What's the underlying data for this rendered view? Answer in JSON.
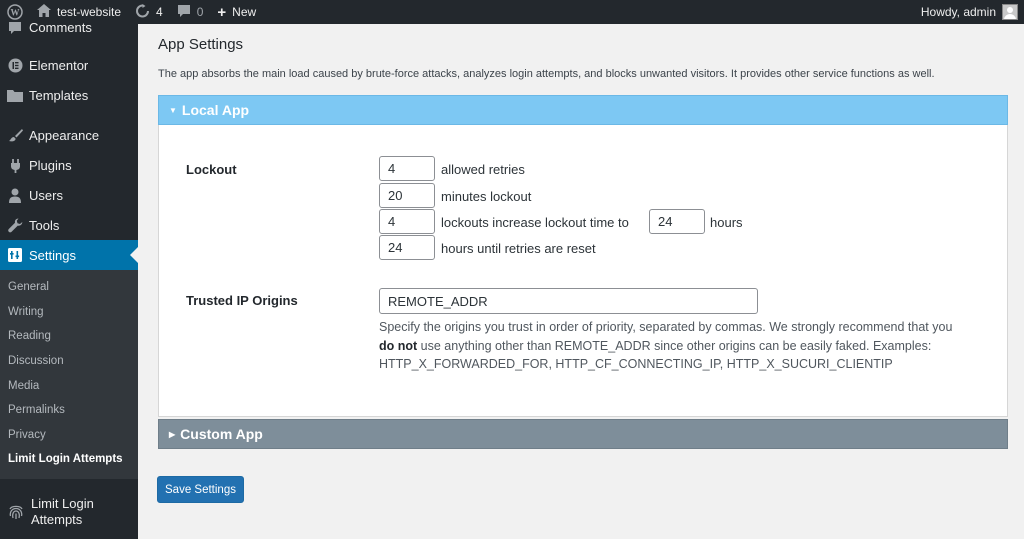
{
  "adminbar": {
    "site_name": "test-website",
    "updates_count": "4",
    "comments_count": "0",
    "new_label": "New",
    "greeting": "Howdy, admin"
  },
  "sidebar": {
    "items": [
      {
        "label": "Comments",
        "icon": "comment-icon"
      },
      {
        "label": "Elementor",
        "icon": "elementor-icon"
      },
      {
        "label": "Templates",
        "icon": "folder-icon"
      },
      {
        "label": "Appearance",
        "icon": "paintbrush-icon"
      },
      {
        "label": "Plugins",
        "icon": "plugin-icon"
      },
      {
        "label": "Users",
        "icon": "users-icon"
      },
      {
        "label": "Tools",
        "icon": "wrench-icon"
      },
      {
        "label": "Settings",
        "icon": "settings-icon"
      }
    ],
    "submenu": [
      "General",
      "Writing",
      "Reading",
      "Discussion",
      "Media",
      "Permalinks",
      "Privacy",
      "Limit Login Attempts"
    ],
    "plugin_item": {
      "line1": "Limit Login",
      "line2": "Attempts",
      "icon": "fingerprint-icon"
    }
  },
  "page": {
    "title": "App Settings",
    "description": "The app absorbs the main load caused by brute-force attacks, analyzes login attempts, and blocks unwanted visitors. It provides other service functions as well."
  },
  "local_app": {
    "header": "Local App",
    "lockout": {
      "label": "Lockout",
      "allowed_retries": "4",
      "allowed_retries_text": "allowed retries",
      "minutes_lockout": "20",
      "minutes_lockout_text": "minutes lockout",
      "lockouts_increase": "4",
      "lockouts_increase_text": "lockouts increase lockout time to",
      "lockout_hours": "24",
      "hours_text": "hours",
      "reset_hours": "24",
      "reset_text": "hours until retries are reset"
    },
    "trusted_ip": {
      "label": "Trusted IP Origins",
      "value": "REMOTE_ADDR",
      "help_before": "Specify the origins you trust in order of priority, separated by commas. We strongly recommend that you ",
      "help_bold": "do not",
      "help_after": " use anything other than REMOTE_ADDR since other origins can be easily faked. Examples: HTTP_X_FORWARDED_FOR, HTTP_CF_CONNECTING_IP, HTTP_X_SUCURI_CLIENTIP"
    }
  },
  "custom_app": {
    "header": "Custom App"
  },
  "save_label": "Save Settings",
  "colors": {
    "admin_bg": "#23282d",
    "accent": "#0073aa",
    "local_app_header": "#7dc8f3",
    "custom_app_header": "#7e8e9a",
    "button": "#2271b1"
  }
}
